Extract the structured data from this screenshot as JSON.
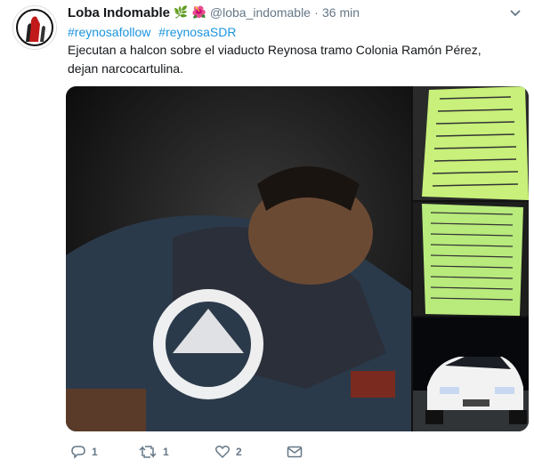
{
  "tweet": {
    "display_name": "Loba Indomable",
    "name_emoji_1": "🌿",
    "name_emoji_2": "🌺",
    "handle": "@loba_indomable",
    "separator": "·",
    "time": "36 min",
    "hashtags": [
      "#reynosafollow",
      "#reynosaSDR"
    ],
    "text": "Ejecutan a halcon sobre el viaducto Reynosa tramo Colonia Ramón Pérez, dejan narcocartulina."
  },
  "media": {
    "main_alt": "photo-main",
    "thumbs": [
      "photo-sign-1",
      "photo-sign-2",
      "photo-car"
    ],
    "sign_text_1": "YA ESTAMOS AQUI...",
    "sign_text_2": "Esto es un llamado..."
  },
  "actions": {
    "reply_count": "1",
    "retweet_count": "1",
    "like_count": "2"
  },
  "colors": {
    "link": "#1b95e0",
    "meta": "#657786",
    "text": "#14171a"
  }
}
